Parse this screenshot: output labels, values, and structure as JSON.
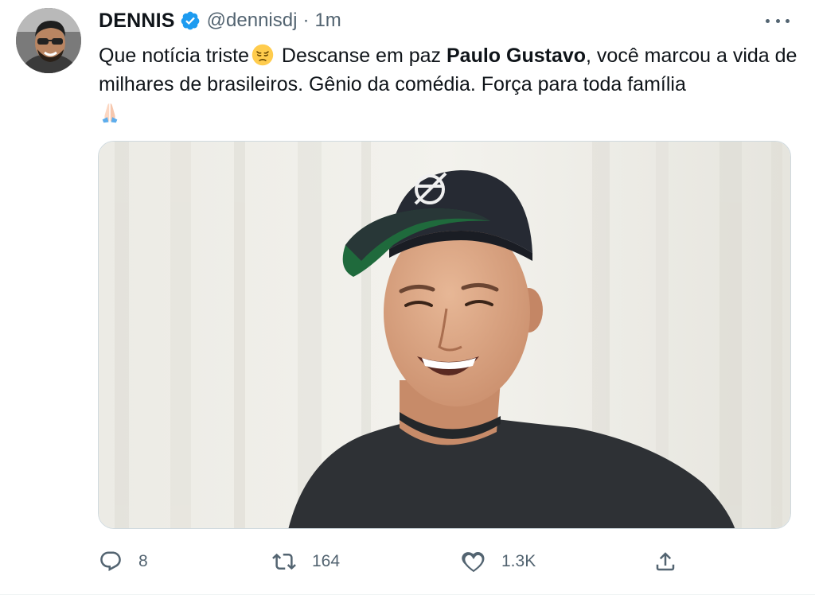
{
  "author": {
    "name": "DENNIS",
    "handle": "@dennisdj",
    "separator": "·",
    "time": "1m",
    "verified": true
  },
  "tweet": {
    "text_part1": "Que notícia triste",
    "text_part2": " Descanse em paz ",
    "text_bold": "Paulo Gustavo",
    "text_part3": ", você marcou a vida de milhares de brasileiros. Gênio da comédia. Força para toda família",
    "emoji_1": "pensive-face-emoji",
    "emoji_2": "folded-hands-emoji"
  },
  "media": {
    "icon": "photo-of-smiling-man-in-cap",
    "cap_logo": "Ø"
  },
  "actions": {
    "reply": {
      "icon": "reply-icon",
      "count": "8"
    },
    "retweet": {
      "icon": "retweet-icon",
      "count": "164"
    },
    "like": {
      "icon": "heart-icon",
      "count": "1.3K"
    },
    "share": {
      "icon": "share-icon"
    }
  },
  "colors": {
    "text": "#0f1419",
    "secondary": "#536471",
    "verified": "#1d9bf0",
    "border": "#cfd9de"
  }
}
